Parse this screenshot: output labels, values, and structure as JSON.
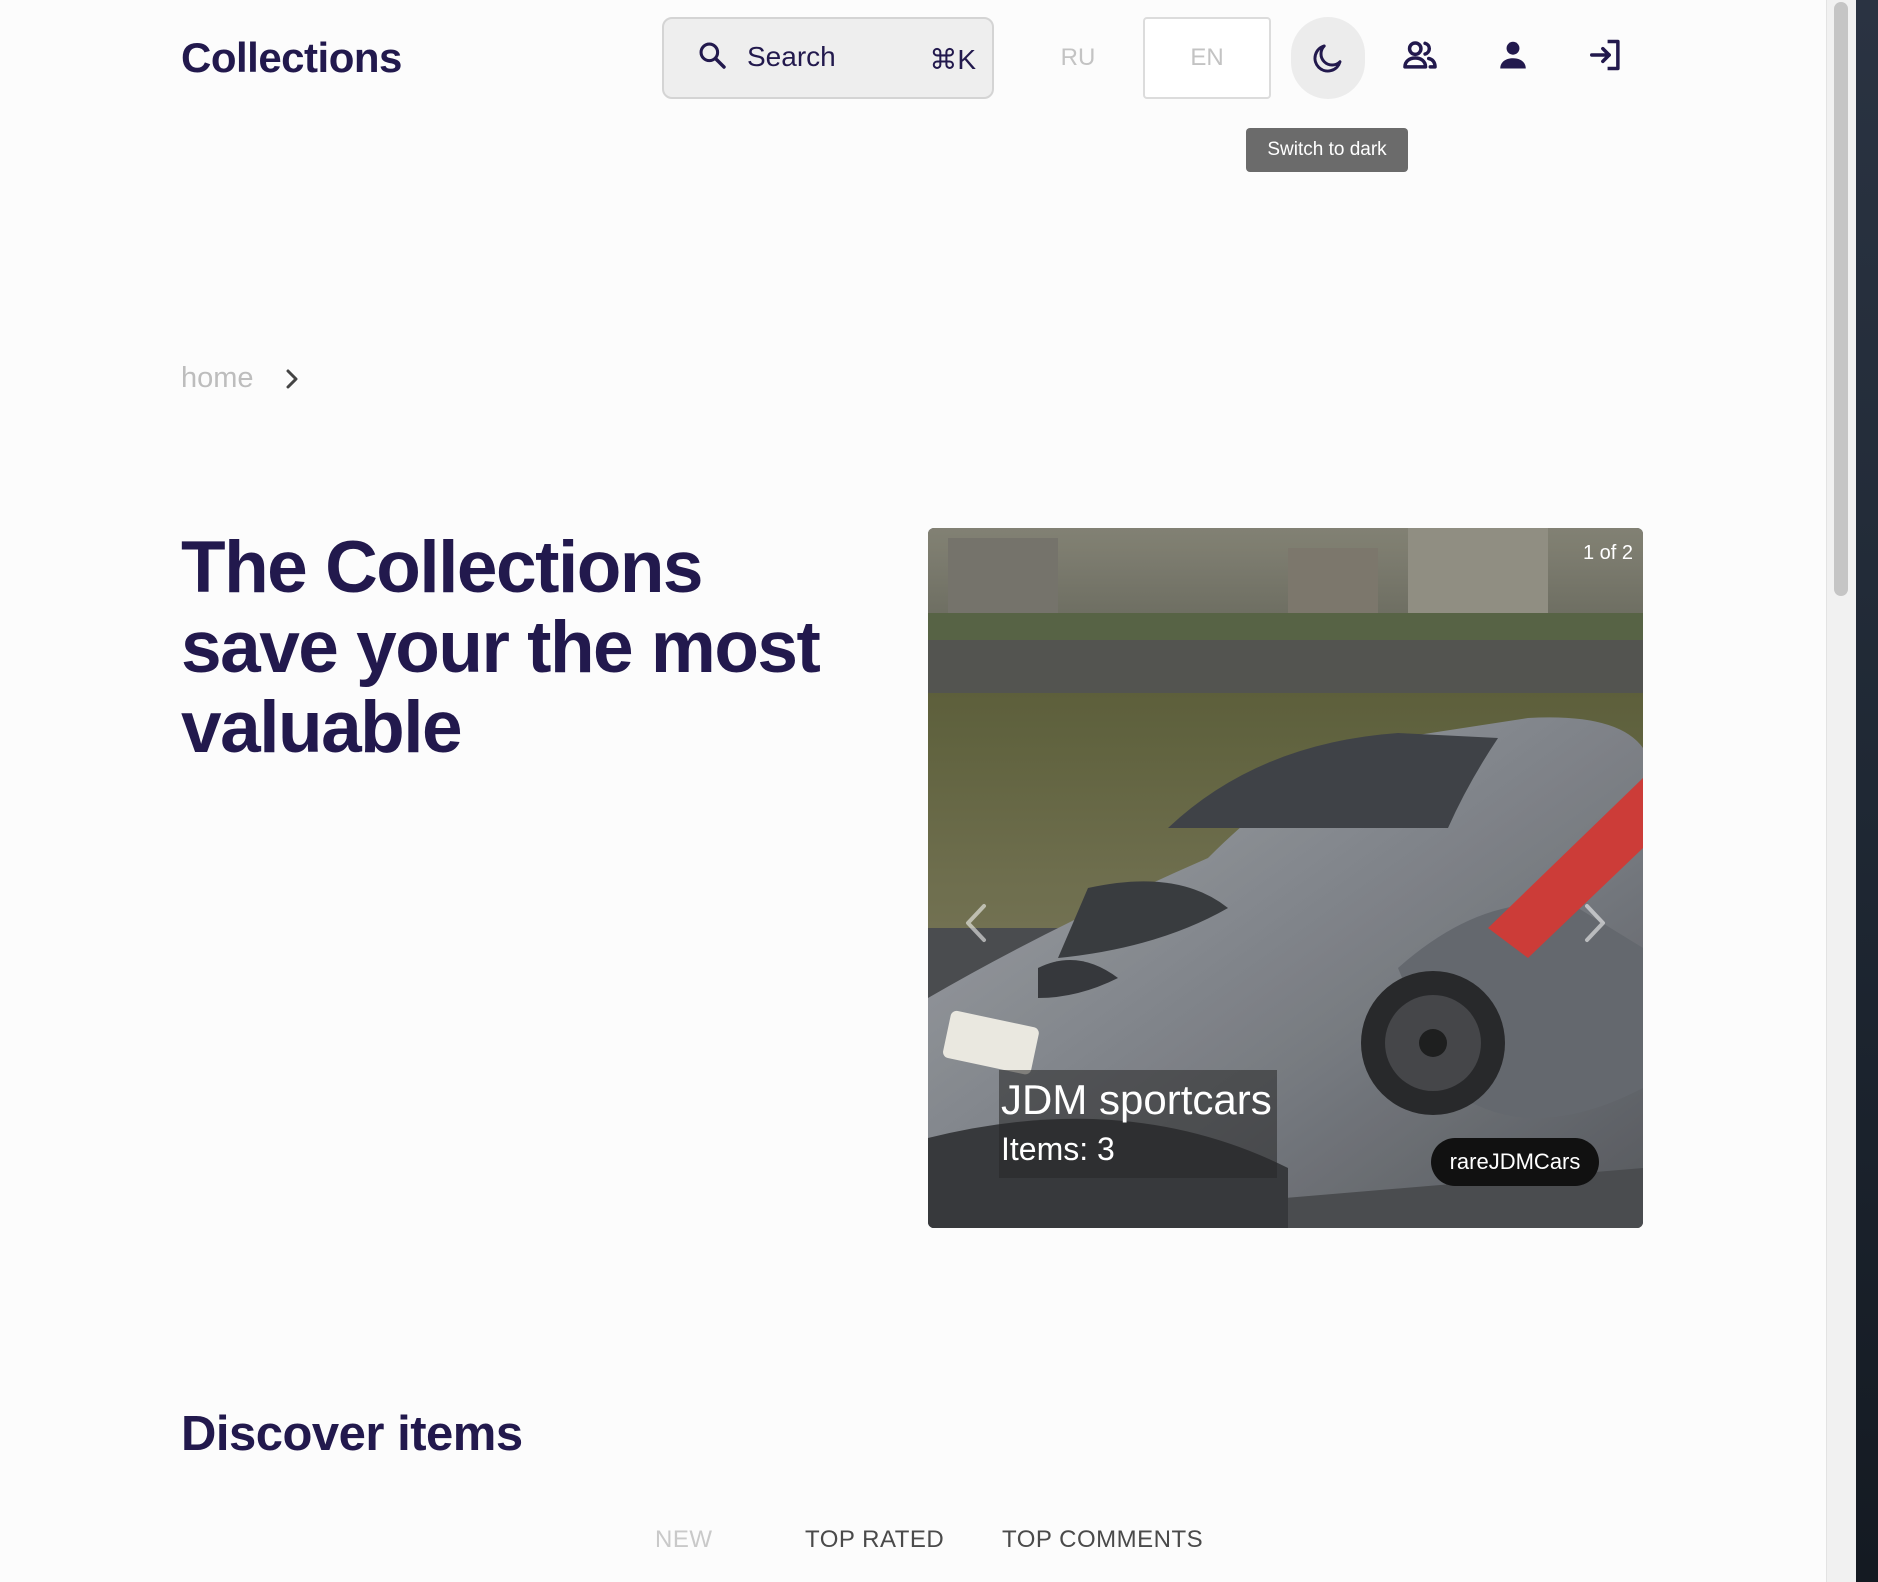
{
  "header": {
    "logo": "Collections",
    "search": {
      "label": "Search",
      "shortcut": "⌘K"
    },
    "languages": {
      "ru": "RU",
      "en": "EN",
      "selected": "EN"
    },
    "theme_tooltip": "Switch to dark",
    "icons": [
      "moon-icon",
      "users-icon",
      "user-icon",
      "login-icon"
    ]
  },
  "breadcrumb": {
    "home": "home"
  },
  "hero": {
    "title": "The Collections save your the most valuable"
  },
  "carousel": {
    "counter": "1 of 2",
    "slide": {
      "title": "JDM sportcars",
      "items": "Items: 3",
      "tag": "rareJDMCars"
    }
  },
  "discover": {
    "title": "Discover items",
    "tabs": {
      "new": "NEW",
      "top_rated": "TOP RATED",
      "top_comments": "TOP COMMENTS"
    },
    "active_tab": "NEW"
  },
  "colors": {
    "brand": "#22194d",
    "background": "#fcfcfc",
    "tooltip": "#6b6b6b"
  }
}
